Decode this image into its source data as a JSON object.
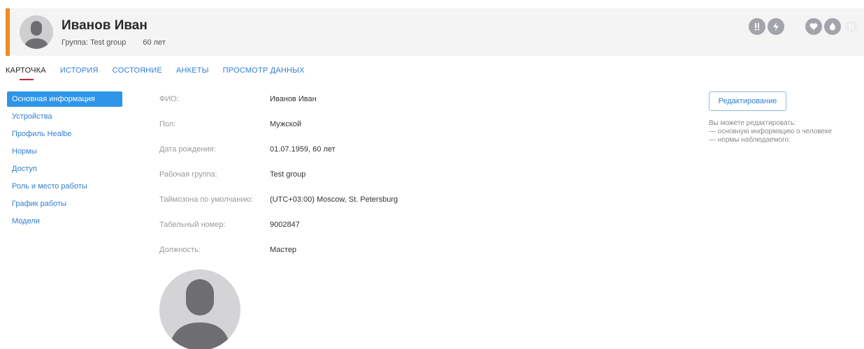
{
  "header": {
    "name": "Иванов Иван",
    "group": "Группа: Test group",
    "age": "60 лет",
    "accent_color": "#ef8c1d",
    "status_icons": [
      {
        "name": "alert-icon",
        "active": true
      },
      {
        "name": "lightning-icon",
        "active": true
      },
      {
        "name": "moon-icon",
        "active": false
      },
      {
        "name": "heart-icon",
        "active": true
      },
      {
        "name": "drop-icon",
        "active": true
      },
      {
        "name": "fork-icon",
        "active": false
      }
    ]
  },
  "tabs": [
    {
      "label": "КАРТОЧКА",
      "active": true
    },
    {
      "label": "ИСТОРИЯ",
      "active": false
    },
    {
      "label": "СОСТОЯНИЕ",
      "active": false
    },
    {
      "label": "АНКЕТЫ",
      "active": false
    },
    {
      "label": "ПРОСМОТР ДАННЫХ",
      "active": false
    }
  ],
  "sidebar": {
    "items": [
      {
        "label": "Основная информация",
        "active": true
      },
      {
        "label": "Устройства"
      },
      {
        "label": "Профиль Healbe"
      },
      {
        "label": "Нормы"
      },
      {
        "label": "Доступ"
      },
      {
        "label": "Роль и место работы"
      },
      {
        "label": "График работы"
      },
      {
        "label": "Модели"
      }
    ]
  },
  "info": {
    "rows": [
      {
        "label": "ФИО:",
        "value": "Иванов Иван"
      },
      {
        "label": "Пол:",
        "value": "Мужской"
      },
      {
        "label": "Дата рождения:",
        "value": "01.07.1959, 60 лет"
      },
      {
        "label": "Рабочая группа:",
        "value": "Test group"
      },
      {
        "label": "Таймозона по умолчанию:",
        "value": "(UTC+03:00) Moscow, St. Petersburg"
      },
      {
        "label": "Табельный номер:",
        "value": "9002847"
      },
      {
        "label": "Должность:",
        "value": "Мастер"
      }
    ]
  },
  "panel": {
    "edit_label": "Редактирование",
    "hint_title": "Вы можете редактировать:",
    "hint_line1": "— основную информацию о человеке",
    "hint_line2": "— нормы наблюдаемого."
  },
  "colors": {
    "link": "#2f7fd2",
    "active_sidebar": "#2e95e7",
    "tab_underline": "#c0283a"
  }
}
